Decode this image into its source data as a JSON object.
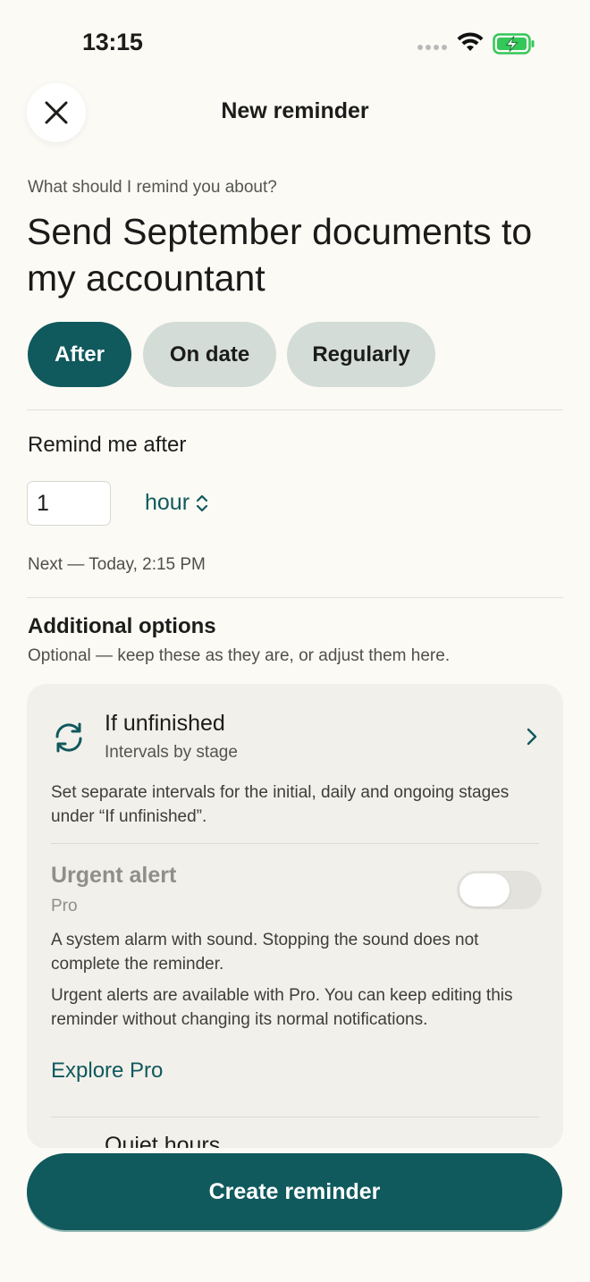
{
  "status_bar": {
    "time": "13:15"
  },
  "header": {
    "title": "New reminder",
    "close_icon": "close-icon"
  },
  "prompt": {
    "label": "What should I remind you about?",
    "text": "Send September documents to my accountant"
  },
  "modes": [
    {
      "label": "After",
      "selected": true
    },
    {
      "label": "On date",
      "selected": false
    },
    {
      "label": "Regularly",
      "selected": false
    }
  ],
  "remind_after": {
    "label": "Remind me after",
    "amount": "1",
    "unit": "hour",
    "next": "Next — Today, 2:15 PM"
  },
  "additional": {
    "title": "Additional options",
    "subtitle": "Optional — keep these as they are, or adjust them here.",
    "if_unfinished": {
      "title": "If unfinished",
      "subtitle": "Intervals by stage",
      "description": "Set separate intervals for the initial, daily and ongoing stages under “If unfinished”.",
      "icon": "refresh-icon"
    },
    "urgent_alert": {
      "title": "Urgent alert",
      "badge": "Pro",
      "enabled": false,
      "description": "A system alarm with sound. Stopping the sound does not complete the reminder.",
      "pro_description": "Urgent alerts are available with Pro. You can keep editing this reminder without changing its normal notifications.",
      "link": "Explore Pro"
    },
    "quiet_hours": {
      "title": "Quiet hours"
    }
  },
  "footer": {
    "create_label": "Create reminder"
  },
  "colors": {
    "accent": "#10595d",
    "chip_bg": "#d3dcd7",
    "background": "#fbfaf5",
    "card_bg": "#f2f0eb"
  }
}
